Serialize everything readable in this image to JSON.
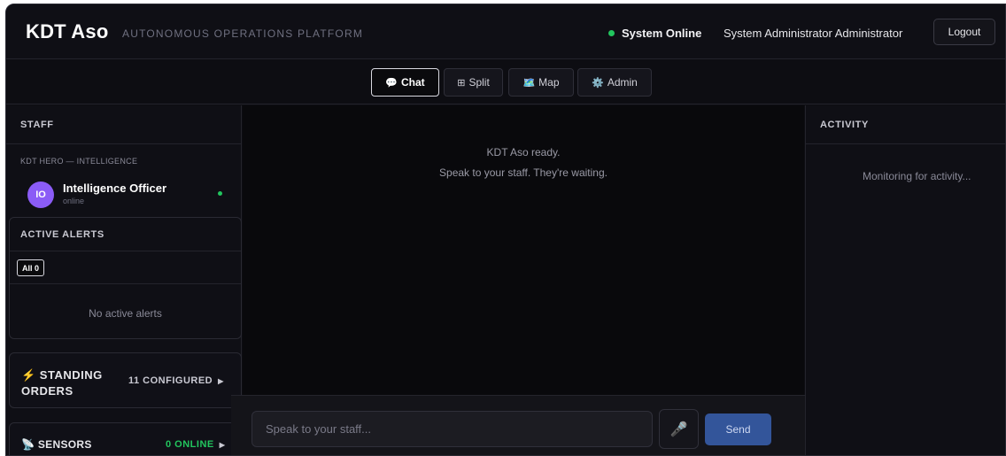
{
  "header": {
    "brand": "KDT Aso",
    "tagline": "AUTONOMOUS OPERATIONS PLATFORM",
    "status": "System Online",
    "user": "System Administrator Administrator",
    "logout_label": "Logout"
  },
  "tabs": [
    {
      "label": "Chat",
      "icon": "💬",
      "active": true
    },
    {
      "label": "Split",
      "icon": "⊞",
      "active": false
    },
    {
      "label": "Map",
      "icon": "🗺️",
      "active": false
    },
    {
      "label": "Admin",
      "icon": "⚙️",
      "active": false
    }
  ],
  "staff": {
    "title": "STAFF",
    "group_label": "KDT HERO — INTELLIGENCE",
    "agent": {
      "initials": "IO",
      "name": "Intelligence Officer",
      "status": "online"
    }
  },
  "alerts": {
    "title": "ACTIVE ALERTS",
    "filter_label": "All 0",
    "empty_text": "No active alerts"
  },
  "standing_orders": {
    "title": "⚡ STANDING ORDERS",
    "count": "11 CONFIGURED",
    "arrow": "▶"
  },
  "sensors": {
    "title": "📡 SENSORS",
    "count": "0 ONLINE",
    "arrow": "▶"
  },
  "chat": {
    "ready_text": "KDT Aso ready.",
    "ready_sub": "Speak to your staff. They're waiting.",
    "input_placeholder": "Speak to your staff...",
    "mic_icon": "🎤",
    "send_label": "Send"
  },
  "activity": {
    "title": "ACTIVITY",
    "empty_text": "Monitoring for activity..."
  },
  "colors": {
    "accent_green": "#22c55e",
    "avatar_purple": "#8b5cf6",
    "send_blue": "#33559a",
    "background": "#0d0d12"
  }
}
